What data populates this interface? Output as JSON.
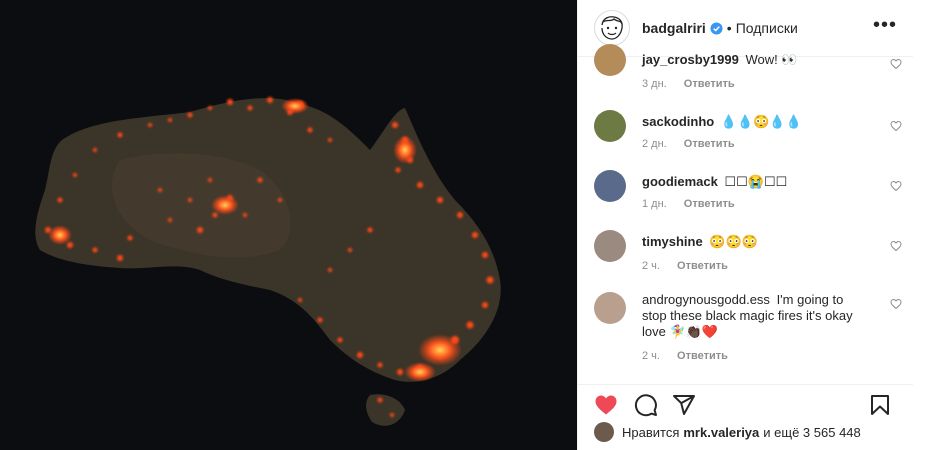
{
  "post": {
    "username": "badgalriri",
    "follow_label": "Подписки",
    "separator": "•",
    "more_label": "•••"
  },
  "comments": [
    {
      "user": "jay_crosby1999",
      "text": "Wow! 👀",
      "time": "3 дн.",
      "reply": "Ответить",
      "avatar_color": "#b38c5a"
    },
    {
      "user": "sackodinho",
      "text": "💧💧😳💧💧",
      "time": "2 дн.",
      "reply": "Ответить",
      "avatar_color": "#6d7a44"
    },
    {
      "user": "goodiemack",
      "text": "☐☐😭☐☐",
      "time": "1 дн.",
      "reply": "Ответить",
      "avatar_color": "#5a6a8a"
    },
    {
      "user": "timyshine",
      "text": "😳😳😳",
      "time": "2 ч.",
      "reply": "Ответить",
      "avatar_color": "#9a8a80"
    },
    {
      "user": "androgynousgodd.ess",
      "text": "I'm going to stop these black magic fires it's okay love 🧚‍♀️👏🏿❤️",
      "time": "2 ч.",
      "reply": "Ответить",
      "avatar_color": "#b9a08e"
    }
  ],
  "likes": {
    "prefix": "Нравится",
    "user": "mrk.valeriya",
    "suffix": "и ещё 3 565 448"
  },
  "colors": {
    "heart": "#ed4956",
    "verified": "#3897f0",
    "muted": "#8e8e8e"
  },
  "icons": [
    "heart-icon",
    "comment-icon",
    "share-icon",
    "bookmark-icon",
    "verified-icon",
    "more-icon"
  ]
}
